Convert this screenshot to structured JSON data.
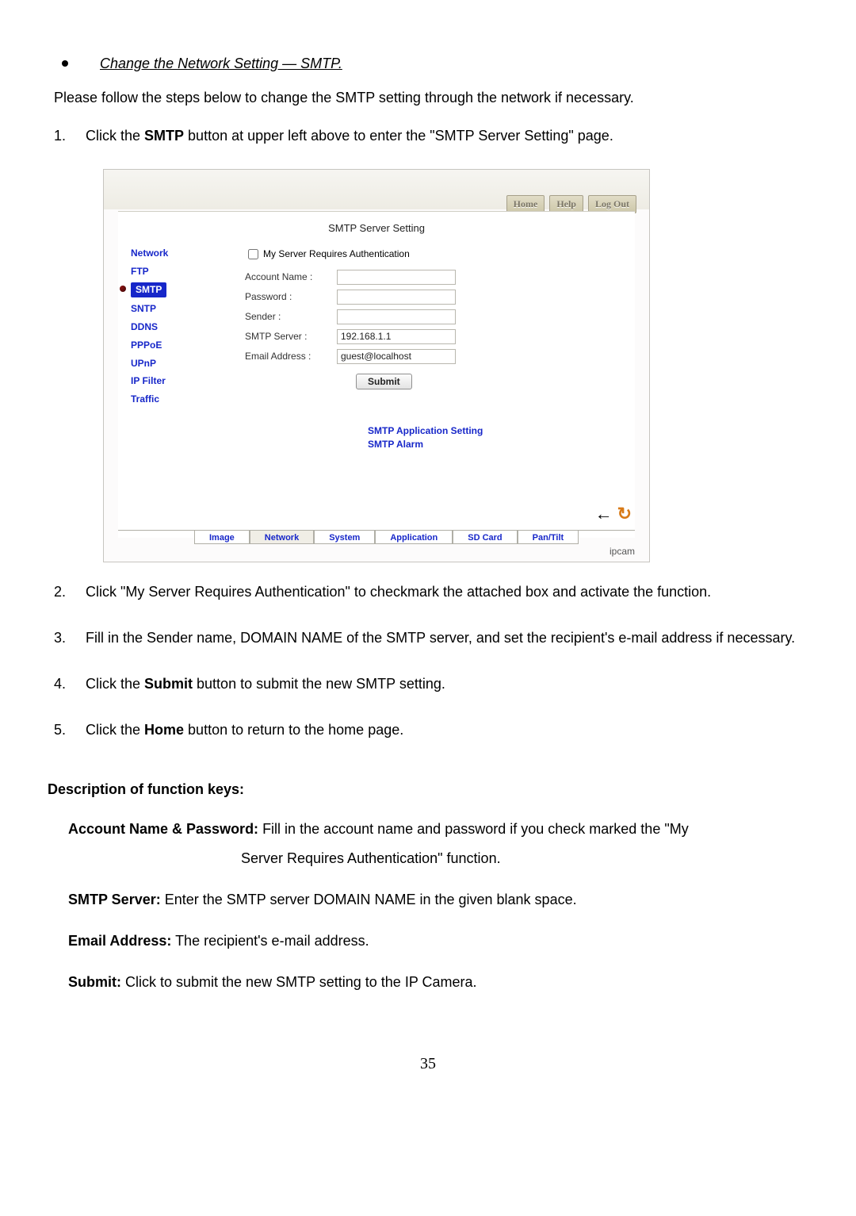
{
  "title_bullet": "Change the Network Setting — SMTP.",
  "intro": "Please follow the steps below to change the SMTP setting through the network if necessary.",
  "steps": [
    {
      "num": "1.",
      "pre": "Click the ",
      "bold": "SMTP",
      "post": " button at upper left above to enter the \"SMTP Server Setting\" page."
    },
    {
      "num": "2.",
      "plain": "Click \"My Server Requires Authentication\" to checkmark the attached box and activate the function."
    },
    {
      "num": "3.",
      "plain": "Fill in the Sender name, DOMAIN NAME of the SMTP server, and set the recipient's e-mail address if necessary."
    },
    {
      "num": "4.",
      "pre": "Click the ",
      "bold": "Submit",
      "post": " button to submit the new SMTP setting."
    },
    {
      "num": "5.",
      "pre": "Click the ",
      "bold": "Home",
      "post": " button to return to the home page."
    }
  ],
  "screenshot": {
    "topButtons": {
      "home": "Home",
      "help": "Help",
      "logout": "Log Out"
    },
    "pageTitle": "SMTP Server Setting",
    "sidebar": [
      "Network",
      "FTP",
      "SMTP",
      "SNTP",
      "DDNS",
      "PPPoE",
      "UPnP",
      "IP Filter",
      "Traffic"
    ],
    "form": {
      "authLabel": "My Server Requires Authentication",
      "accountLabel": "Account Name :",
      "accountValue": "",
      "passwordLabel": "Password :",
      "passwordValue": "",
      "senderLabel": "Sender :",
      "senderValue": "",
      "smtpLabel": "SMTP Server :",
      "smtpValue": "192.168.1.1",
      "emailLabel": "Email Address :",
      "emailValue": "guest@localhost",
      "submit": "Submit"
    },
    "centerLinks": {
      "app": "SMTP Application Setting",
      "alarm": "SMTP Alarm"
    },
    "tabs": [
      "Image",
      "Network",
      "System",
      "Application",
      "SD Card",
      "Pan/Tilt"
    ],
    "brand": "ipcam"
  },
  "descHeading": "Description of function keys:",
  "desc": {
    "d1_bold": "Account Name & Password:",
    "d1_text": " Fill in the account name and password if you check marked the \"My",
    "d1_text2": "Server Requires Authentication\" function.",
    "d2_bold": "SMTP Server:",
    "d2_text": " Enter the SMTP server DOMAIN NAME in the given blank space.",
    "d3_bold": "Email Address:",
    "d3_text": " The recipient's e-mail address.",
    "d4_bold": "Submit:",
    "d4_text": " Click to submit the new SMTP setting to the IP Camera."
  },
  "pageNumber": "35"
}
